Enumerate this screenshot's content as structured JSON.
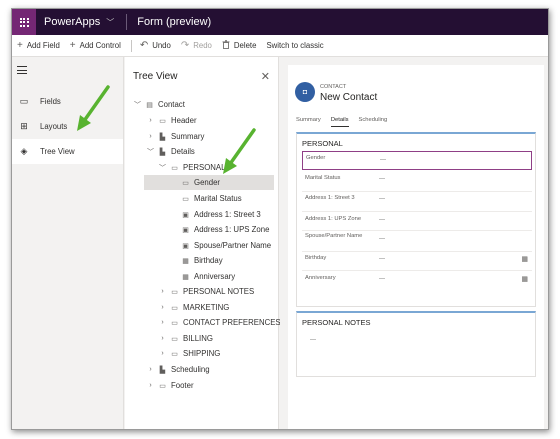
{
  "app": {
    "name": "PowerApps",
    "form_title": "Form (preview)"
  },
  "toolbar": {
    "add_field": "Add Field",
    "add_control": "Add Control",
    "undo": "Undo",
    "redo": "Redo",
    "delete": "Delete",
    "switch_classic": "Switch to classic"
  },
  "rail": {
    "items": [
      {
        "label": "Fields",
        "icon": "fields-icon"
      },
      {
        "label": "Layouts",
        "icon": "layouts-icon"
      },
      {
        "label": "Tree View",
        "icon": "tree-view-icon",
        "active": true
      }
    ]
  },
  "tree": {
    "title": "Tree View",
    "nodes": [
      {
        "label": "Contact"
      },
      {
        "label": "Header"
      },
      {
        "label": "Summary"
      },
      {
        "label": "Details"
      },
      {
        "label": "PERSONAL"
      },
      {
        "label": "Gender",
        "selected": true
      },
      {
        "label": "Marital Status"
      },
      {
        "label": "Address 1: Street 3"
      },
      {
        "label": "Address 1: UPS Zone"
      },
      {
        "label": "Spouse/Partner Name"
      },
      {
        "label": "Birthday"
      },
      {
        "label": "Anniversary"
      },
      {
        "label": "PERSONAL NOTES"
      },
      {
        "label": "MARKETING"
      },
      {
        "label": "CONTACT PREFERENCES"
      },
      {
        "label": "BILLING"
      },
      {
        "label": "SHIPPING"
      },
      {
        "label": "Scheduling"
      },
      {
        "label": "Footer"
      }
    ]
  },
  "form": {
    "entity": "CONTACT",
    "record_name": "New Contact",
    "tabs": [
      {
        "label": "Summary"
      },
      {
        "label": "Details",
        "active": true
      },
      {
        "label": "Scheduling"
      }
    ],
    "personal_section": {
      "title": "PERSONAL",
      "fields": [
        {
          "label": "Gender",
          "value": "---",
          "selected": true
        },
        {
          "label": "Marital Status",
          "value": "---"
        },
        {
          "label": "Address 1: Street 3",
          "value": "---"
        },
        {
          "label": "Address 1: UPS Zone",
          "value": "---"
        },
        {
          "label": "Spouse/Partner Name",
          "value": "---"
        },
        {
          "label": "Birthday",
          "value": "---",
          "calendar": true
        },
        {
          "label": "Anniversary",
          "value": "---",
          "calendar": true
        }
      ]
    },
    "notes_section": {
      "title": "PERSONAL NOTES",
      "value": "---"
    }
  },
  "colors": {
    "topbar": "#240f33",
    "waffle": "#742774",
    "selection_outline": "#8f3f86",
    "section_accent": "#7aa7d4",
    "annotation_arrow": "#58b330"
  }
}
